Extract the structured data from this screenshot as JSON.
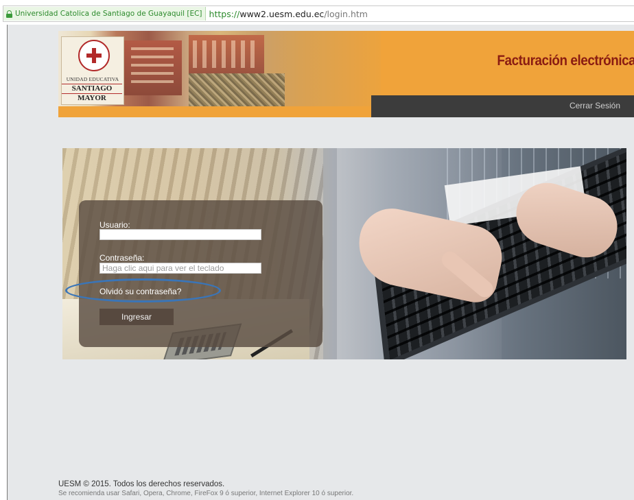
{
  "browser": {
    "cert_label": "Universidad Catolica de Santiago de Guayaquil [EC]",
    "url_protocol": "https://",
    "url_host": "www2.uesm.edu.ec",
    "url_path": "/login.htm"
  },
  "header": {
    "logo_line1": "UNIDAD EDUCATIVA",
    "logo_line2": "SANTIAGO",
    "logo_line3": "MAYOR",
    "title": "Facturación electrónica",
    "logout_label": "Cerrar Sesión"
  },
  "login": {
    "user_label": "Usuario:",
    "user_value": "",
    "password_label": "Contraseña:",
    "password_placeholder": "Haga clic aqui para ver el teclado",
    "forgot_label": "Olvidó su contraseña?",
    "submit_label": "Ingresar"
  },
  "footer": {
    "copyright": "UESM © 2015. Todos los derechos reservados.",
    "recommendation": "Se recomienda usar Safari, Opera, Chrome, FireFox 9 ó superior, Internet Explorer 10 ó superior."
  },
  "colors": {
    "banner_orange": "#f0a33a",
    "title_red": "#8a1c12",
    "highlight_blue": "#3a75b8"
  }
}
